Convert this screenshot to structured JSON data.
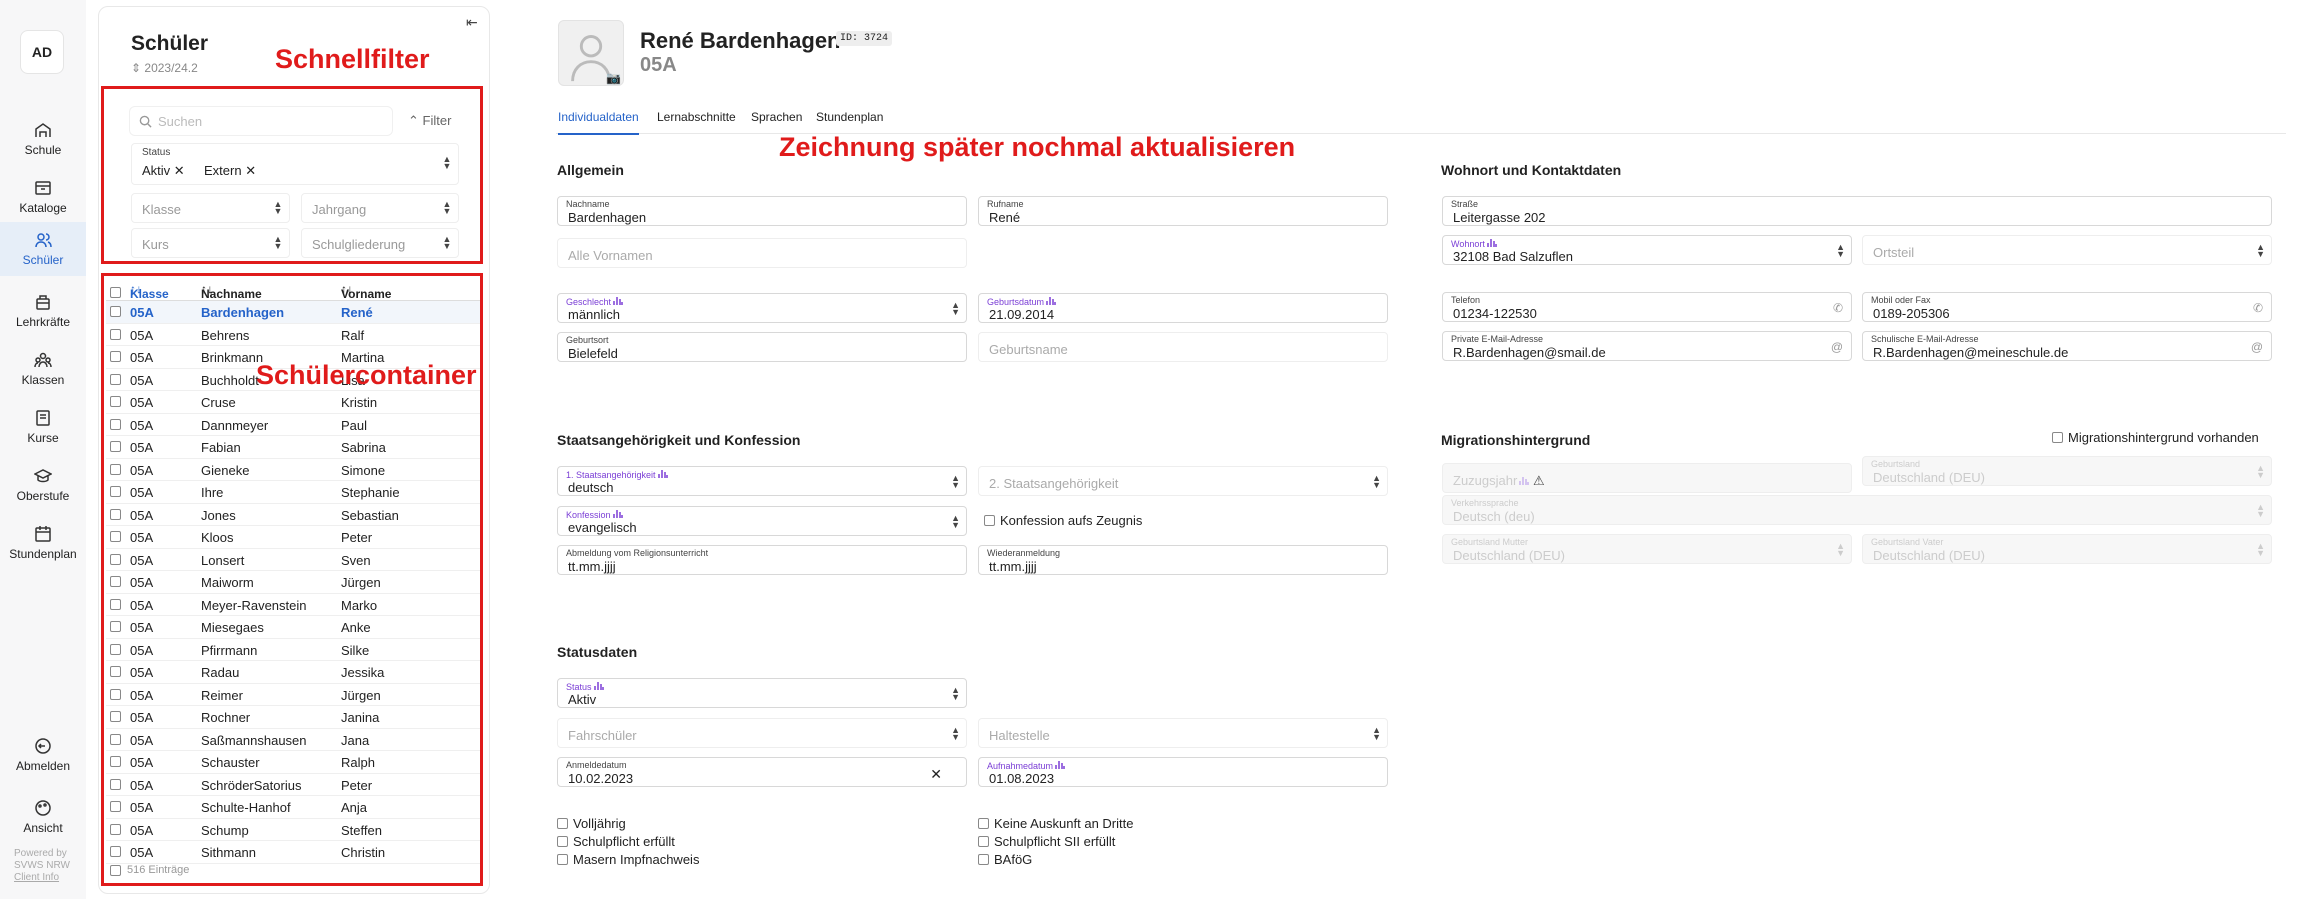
{
  "nav": {
    "avatar": "AD",
    "items": [
      {
        "label": "Schule",
        "icon": "school-icon"
      },
      {
        "label": "Kataloge",
        "icon": "catalog-icon"
      },
      {
        "label": "Schüler",
        "icon": "students-icon",
        "active": true
      },
      {
        "label": "Lehrkräfte",
        "icon": "teachers-icon"
      },
      {
        "label": "Klassen",
        "icon": "classes-icon"
      },
      {
        "label": "Kurse",
        "icon": "courses-icon"
      },
      {
        "label": "Oberstufe",
        "icon": "graduation-icon"
      },
      {
        "label": "Stundenplan",
        "icon": "schedule-icon"
      }
    ],
    "logout": "Abmelden",
    "view": "Ansicht",
    "powered1": "Powered by",
    "powered2": "SVWS NRW",
    "client_info": "Client Info"
  },
  "list": {
    "title": "Schüler",
    "year": "2023/24.2",
    "search_placeholder": "Suchen",
    "filter_label": "Filter",
    "status_label": "Status",
    "status_tags": [
      "Aktiv",
      "Extern"
    ],
    "klasse_placeholder": "Klasse",
    "jahrgang_placeholder": "Jahrgang",
    "kurs_placeholder": "Kurs",
    "schulgliederung_placeholder": "Schulgliederung",
    "col_klasse": "Klasse",
    "col_nachname": "Nachname",
    "col_vorname": "Vorname",
    "rows": [
      [
        "05A",
        "Bardenhagen",
        "René"
      ],
      [
        "05A",
        "Behrens",
        "Ralf"
      ],
      [
        "05A",
        "Brinkmann",
        "Martina"
      ],
      [
        "05A",
        "Buchholdt",
        "Lisa"
      ],
      [
        "05A",
        "Cruse",
        "Kristin"
      ],
      [
        "05A",
        "Dannmeyer",
        "Paul"
      ],
      [
        "05A",
        "Fabian",
        "Sabrina"
      ],
      [
        "05A",
        "Gieneke",
        "Simone"
      ],
      [
        "05A",
        "Ihre",
        "Stephanie"
      ],
      [
        "05A",
        "Jones",
        "Sebastian"
      ],
      [
        "05A",
        "Kloos",
        "Peter"
      ],
      [
        "05A",
        "Lonsert",
        "Sven"
      ],
      [
        "05A",
        "Maiworm",
        "Jürgen"
      ],
      [
        "05A",
        "Meyer-Ravenstein",
        "Marko"
      ],
      [
        "05A",
        "Miesegaes",
        "Anke"
      ],
      [
        "05A",
        "Pfirrmann",
        "Silke"
      ],
      [
        "05A",
        "Radau",
        "Jessika"
      ],
      [
        "05A",
        "Reimer",
        "Jürgen"
      ],
      [
        "05A",
        "Rochner",
        "Janina"
      ],
      [
        "05A",
        "Saßmannshausen",
        "Jana"
      ],
      [
        "05A",
        "Schauster",
        "Ralph"
      ],
      [
        "05A",
        "SchröderSatorius",
        "Peter"
      ],
      [
        "05A",
        "Schulte-Hanhof",
        "Anja"
      ],
      [
        "05A",
        "Schump",
        "Steffen"
      ],
      [
        "05A",
        "Sithmann",
        "Christin"
      ]
    ],
    "count": "516 Einträge"
  },
  "annotations": {
    "schnellfilter": "Schnellfilter",
    "schuelercontainer": "Schülercontainer",
    "zeichnung": "Zeichnung später nochmal aktualisieren",
    "color": "#e01b1b"
  },
  "student": {
    "name": "René Bardenhagen",
    "id": "ID: 3724",
    "klasse": "05A"
  },
  "tabs": [
    "Individualdaten",
    "Lernabschnitte",
    "Sprachen",
    "Stundenplan"
  ],
  "allgemein": {
    "title": "Allgemein",
    "nachname_label": "Nachname",
    "nachname": "Bardenhagen",
    "rufname_label": "Rufname",
    "rufname": "René",
    "vornamen_placeholder": "Alle Vornamen",
    "geschlecht_label": "Geschlecht",
    "geschlecht": "männlich",
    "geburtsdatum_label": "Geburtsdatum",
    "geburtsdatum": "21.09.2014",
    "geburtsort_label": "Geburtsort",
    "geburtsort": "Bielefeld",
    "geburtsname_placeholder": "Geburtsname"
  },
  "wohnort": {
    "title": "Wohnort und Kontaktdaten",
    "strasse_label": "Straße",
    "strasse": "Leitergasse 202",
    "wohnort_label": "Wohnort",
    "wohnort": "32108 Bad Salzuflen",
    "ortsteil_placeholder": "Ortsteil",
    "telefon_label": "Telefon",
    "telefon": "01234-122530",
    "mobil_label": "Mobil oder Fax",
    "mobil": "0189-205306",
    "email_priv_label": "Private E-Mail-Adresse",
    "email_priv": "R.Bardenhagen@smail.de",
    "email_schul_label": "Schulische E-Mail-Adresse",
    "email_schul": "R.Bardenhagen@meineschule.de"
  },
  "staat": {
    "title": "Staatsangehörigkeit und Konfession",
    "sa1_label": "1. Staatsangehörigkeit",
    "sa1": "deutsch",
    "sa2_placeholder": "2. Staatsangehörigkeit",
    "konfession_label": "Konfession",
    "konfession": "evangelisch",
    "konf_zeugnis": "Konfession aufs Zeugnis",
    "abmeldung_label": "Abmeldung vom Religionsunterricht",
    "abmeldung": "tt.mm.jjjj",
    "wiederanmeldung_label": "Wiederanmeldung",
    "wiederanmeldung": "tt.mm.jjjj"
  },
  "migration": {
    "title": "Migrationshintergrund",
    "checkbox": "Migrationshintergrund vorhanden",
    "zuzugsjahr": "Zuzugsjahr",
    "geburtsland_label": "Geburtsland",
    "geburtsland": "Deutschland (DEU)",
    "verkehrssprache_label": "Verkehrssprache",
    "verkehrssprache": "Deutsch (deu)",
    "gl_mutter_label": "Geburtsland Mutter",
    "gl_mutter": "Deutschland (DEU)",
    "gl_vater_label": "Geburtsland Vater",
    "gl_vater": "Deutschland (DEU)"
  },
  "status": {
    "title": "Statusdaten",
    "status_label": "Status",
    "status": "Aktiv",
    "fahrschueler_placeholder": "Fahrschüler",
    "haltestelle_placeholder": "Haltestelle",
    "anmeldedatum_label": "Anmeldedatum",
    "anmeldedatum": "10.02.2023",
    "aufnahmedatum_label": "Aufnahmedatum",
    "aufnahmedatum": "01.08.2023",
    "checks_left": [
      "Volljährig",
      "Schulpflicht erfüllt",
      "Masern Impfnachweis"
    ],
    "checks_right": [
      "Keine Auskunft an Dritte",
      "Schulpflicht SII erfüllt",
      "BAföG"
    ]
  }
}
